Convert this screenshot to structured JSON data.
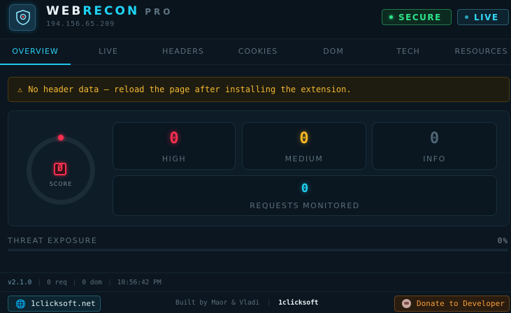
{
  "header": {
    "brand_main": "WEB",
    "brand_accent": "RECON",
    "brand_suffix": "PRO",
    "ip": "194.156.65.209",
    "secure_label": "SECURE",
    "live_label": "LIVE"
  },
  "tabs": [
    {
      "label": "OVERVIEW",
      "active": true
    },
    {
      "label": "LIVE"
    },
    {
      "label": "HEADERS"
    },
    {
      "label": "COOKIES"
    },
    {
      "label": "DOM"
    },
    {
      "label": "TECH"
    },
    {
      "label": "RESOURCES"
    }
  ],
  "warning": {
    "icon": "warning-icon",
    "text": "No header data — reload the page after installing the extension."
  },
  "score": {
    "value": "Ø",
    "label": "SCORE"
  },
  "stats": {
    "high": {
      "value": "0",
      "label": "HIGH",
      "color": "#ff2e50"
    },
    "medium": {
      "value": "0",
      "label": "MEDIUM",
      "color": "#f5b622"
    },
    "info": {
      "value": "0",
      "label": "INFO",
      "color": "#4e6675"
    },
    "requests": {
      "value": "0",
      "label": "REQUESTS MONITORED",
      "color": "#1fd3f5"
    }
  },
  "threat": {
    "label": "THREAT EXPOSURE",
    "percent_text": "0%",
    "percent": 0
  },
  "status": {
    "version": "v2.1.0",
    "requests": "0 req",
    "dom": "0 dom",
    "time": "10:56:42 PM"
  },
  "footer": {
    "site_label": "1clicksoft.net",
    "credits": "Built by Maor & Vladi",
    "company": "1clicksoft",
    "donate_label": "Donate to Developer"
  },
  "colors": {
    "accent": "#1fd3f5",
    "secure": "#2de38a",
    "warning": "#f0b731",
    "danger": "#ff2e50",
    "donate": "#f39a3a"
  }
}
